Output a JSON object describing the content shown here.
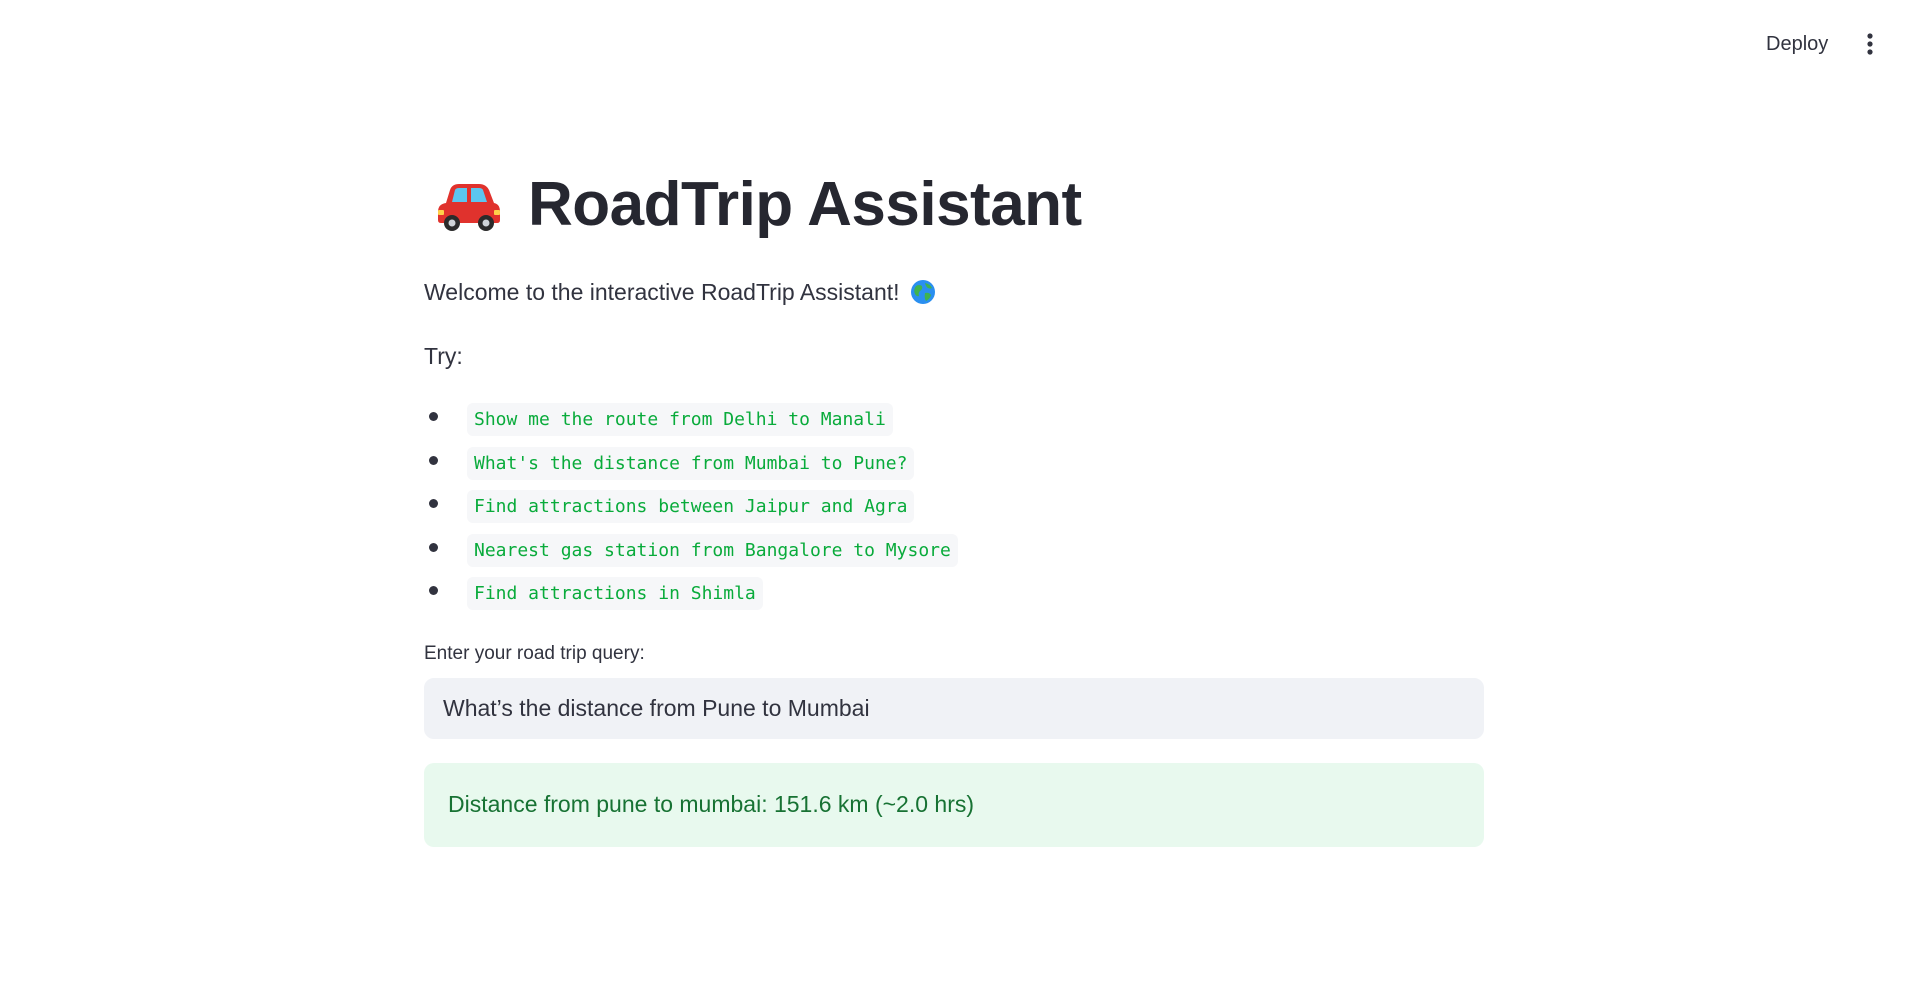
{
  "header": {
    "deploy_label": "Deploy",
    "menu_icon": "vertical-ellipsis-icon"
  },
  "main": {
    "title": "RoadTrip Assistant",
    "title_icon": "car-icon",
    "welcome_text": "Welcome to the interactive RoadTrip Assistant!",
    "welcome_icon": "globe-icon",
    "try_label": "Try:",
    "examples": [
      "Show me the route from Delhi to Manali",
      "What's the distance from Mumbai to Pune?",
      "Find attractions between Jaipur and Agra",
      "Nearest gas station from Bangalore to Mysore",
      "Find attractions in Shimla"
    ],
    "query_label": "Enter your road trip query:",
    "query_value": "What’s the distance from Pune to Mumbai",
    "result_text": "Distance from pune to mumbai: 151.6 km (~2.0 hrs)"
  },
  "colors": {
    "code_text": "#09ab3b",
    "success_bg": "#e8f9ee",
    "success_text": "#177233",
    "input_bg": "#f0f2f6"
  }
}
